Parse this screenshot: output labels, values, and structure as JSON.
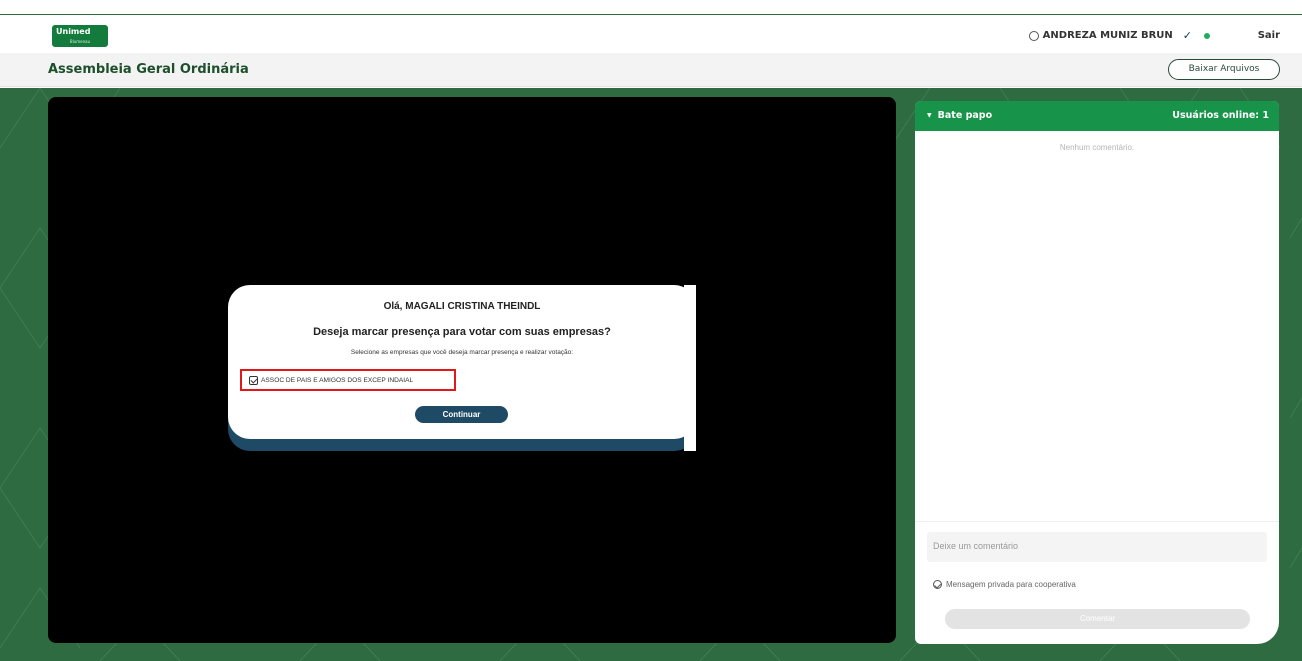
{
  "header": {
    "logo_text": "Unimed",
    "logo_sub": "Blumenau",
    "user_name": "ANDREZA MUNIZ BRUN",
    "logout_label": "Sair",
    "brand_color": "#17944a"
  },
  "subheader": {
    "title": "Assembleia Geral Ordinária",
    "download_button": "Baixar Arquivos"
  },
  "modal": {
    "greeting": "Olá, MAGALI CRISTINA THEINDL",
    "question": "Deseja marcar presença para votar com suas empresas?",
    "instruction": "Selecione as empresas que você deseja marcar presença e realizar votação:",
    "company": {
      "label": "ASSOC DE PAIS E AMIGOS DOS EXCEP INDAIAL",
      "checked": true
    },
    "continue_button": "Continuar"
  },
  "chat": {
    "title": "Bate papo",
    "online_users": "Usuários online: 1",
    "empty_text": "Nenhum comentário.",
    "input_placeholder": "Deixe um comentário",
    "private_label": "Mensagem privada para cooperativa",
    "send_button": "Comentar"
  }
}
